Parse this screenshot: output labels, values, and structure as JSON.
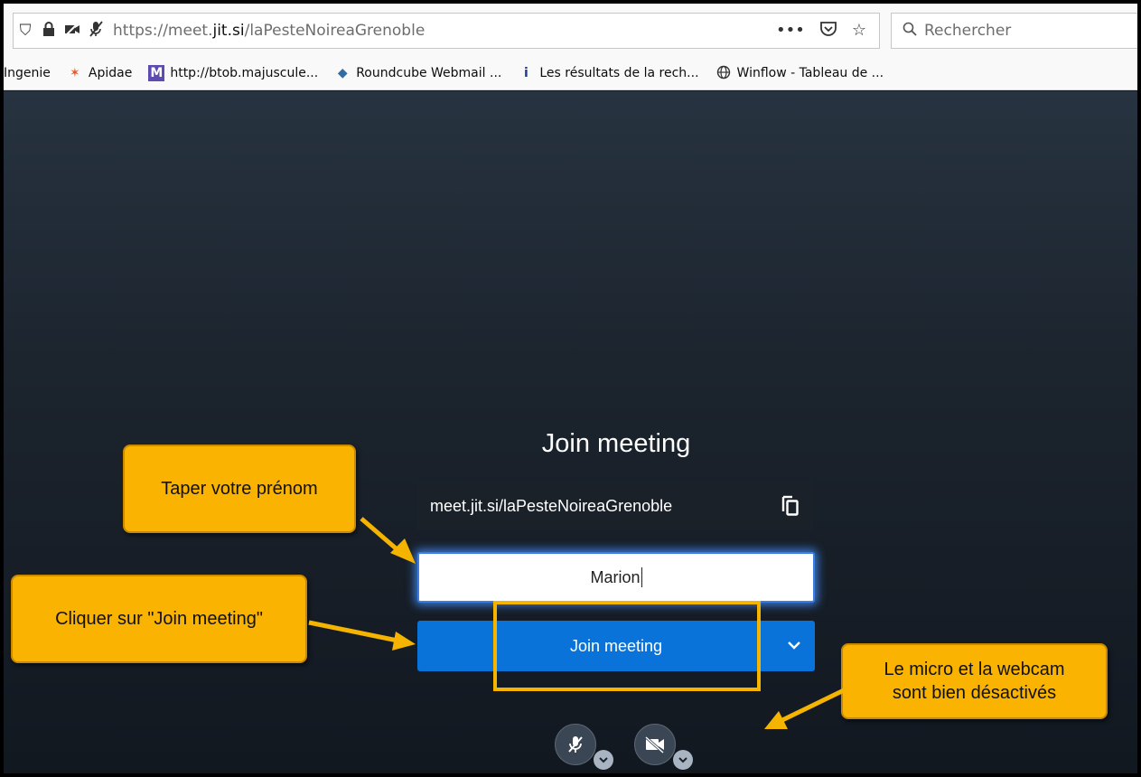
{
  "browser": {
    "url_prefix": "https://meet.",
    "url_domain": "jit.si",
    "url_path": "/laPesteNoireaGrenoble",
    "url_more": "•••",
    "search_placeholder": "Rechercher"
  },
  "bookmarks": [
    {
      "label": "Ingenie",
      "icon": ""
    },
    {
      "label": "Apidae",
      "icon": "apidae-icon"
    },
    {
      "label": "http://btob.majuscule...",
      "icon": "m-logo-icon"
    },
    {
      "label": "Roundcube Webmail ...",
      "icon": "roundcube-icon"
    },
    {
      "label": "Les résultats de la rech...",
      "icon": "info-icon"
    },
    {
      "label": "Winflow - Tableau de ...",
      "icon": "globe-icon"
    }
  ],
  "meeting": {
    "title": "Join meeting",
    "room_url": "meet.jit.si/laPesteNoireaGrenoble",
    "name_value": "Marion",
    "join_label": "Join meeting"
  },
  "annotations": {
    "callout_name": "Taper votre prénom",
    "callout_join": "Cliquer sur \"Join meeting\"",
    "callout_media_line1": "Le micro et la webcam",
    "callout_media_line2": "sont bien désactivés"
  },
  "colors": {
    "accent": "#0a73d9",
    "callout": "#f9b300",
    "page_bg": "#151a21"
  }
}
